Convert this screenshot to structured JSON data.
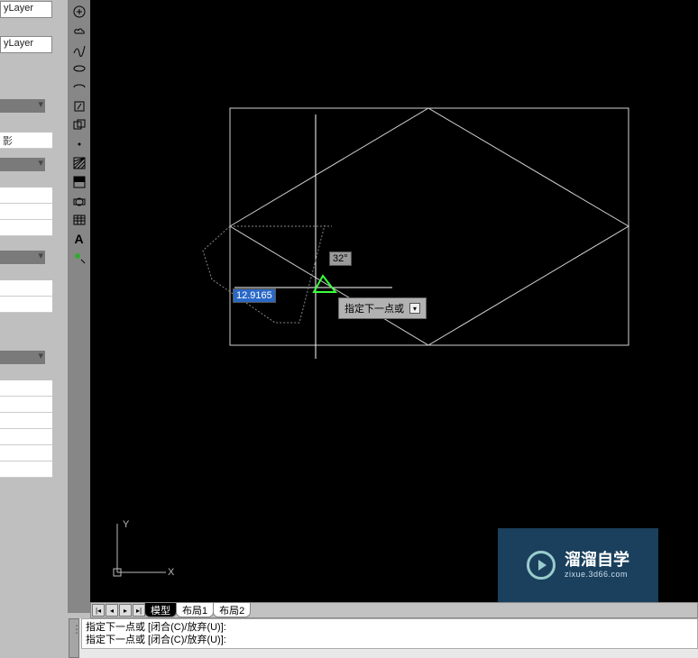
{
  "properties_panel": {
    "field1_value": "yLayer",
    "field2_value": "yLayer",
    "shadow_label": "影"
  },
  "canvas": {
    "dynamic_distance": "12.9165",
    "dynamic_angle": "32°",
    "tooltip_text": "指定下一点或",
    "ucs_x": "X",
    "ucs_y": "Y"
  },
  "tabs": {
    "model": "模型",
    "layout1": "布局1",
    "layout2": "布局2"
  },
  "command_lines": {
    "line1": "指定下一点或 [闭合(C)/放弃(U)]:",
    "line2": "指定下一点或 [闭合(C)/放弃(U)]:"
  },
  "watermark": {
    "title": "溜溜自学",
    "url": "zixue.3d66.com"
  }
}
